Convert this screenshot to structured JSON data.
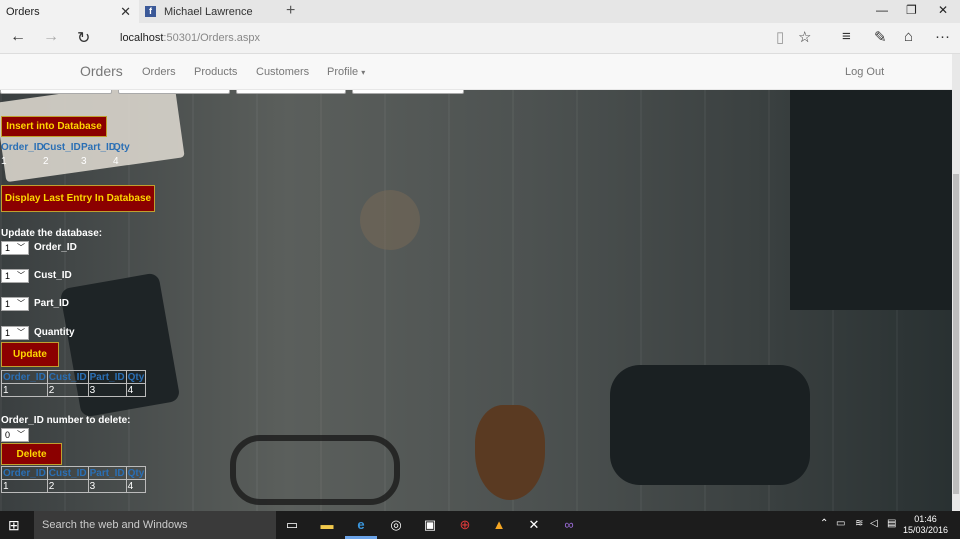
{
  "browser": {
    "tabs": [
      {
        "label": "Orders",
        "icon": "page-icon"
      },
      {
        "label": "Michael Lawrence",
        "icon": "facebook-icon"
      }
    ],
    "url_host": "localhost",
    "url_path": ":50301/Orders.aspx"
  },
  "navbar": {
    "brand": "Orders",
    "links": [
      "Orders",
      "Products",
      "Customers",
      "Profile"
    ],
    "logout": "Log Out"
  },
  "insert_section": {
    "button": "Insert into Database",
    "headers": [
      "Order_ID",
      "Cust_ID",
      "Part_ID",
      "Qty"
    ],
    "values": [
      "1",
      "2",
      "3",
      "4"
    ]
  },
  "display_section": {
    "button": "Display Last Entry In Database"
  },
  "update_section": {
    "title": "Update the database:",
    "fields": [
      {
        "selected": "1",
        "label": "Order_ID"
      },
      {
        "selected": "1",
        "label": "Cust_ID"
      },
      {
        "selected": "1",
        "label": "Part_ID"
      },
      {
        "selected": "1",
        "label": "Quantity"
      }
    ],
    "button": "Update",
    "headers": [
      "Order_ID",
      "Cust_ID",
      "Part_ID",
      "Qty"
    ],
    "values": [
      "1",
      "2",
      "3",
      "4"
    ]
  },
  "delete_section": {
    "title": "Order_ID number to delete:",
    "selected": "0",
    "button": "Delete",
    "headers": [
      "Order_ID",
      "Cust_ID",
      "Part_ID",
      "Qty"
    ],
    "values": [
      "1",
      "2",
      "3",
      "4"
    ]
  },
  "taskbar": {
    "search_placeholder": "Search the web and Windows",
    "time": "01:46",
    "date": "15/03/2016"
  },
  "colors": {
    "button_bg": "#8b0000",
    "button_text": "#ffd700",
    "header_text": "#2a6fb5"
  }
}
